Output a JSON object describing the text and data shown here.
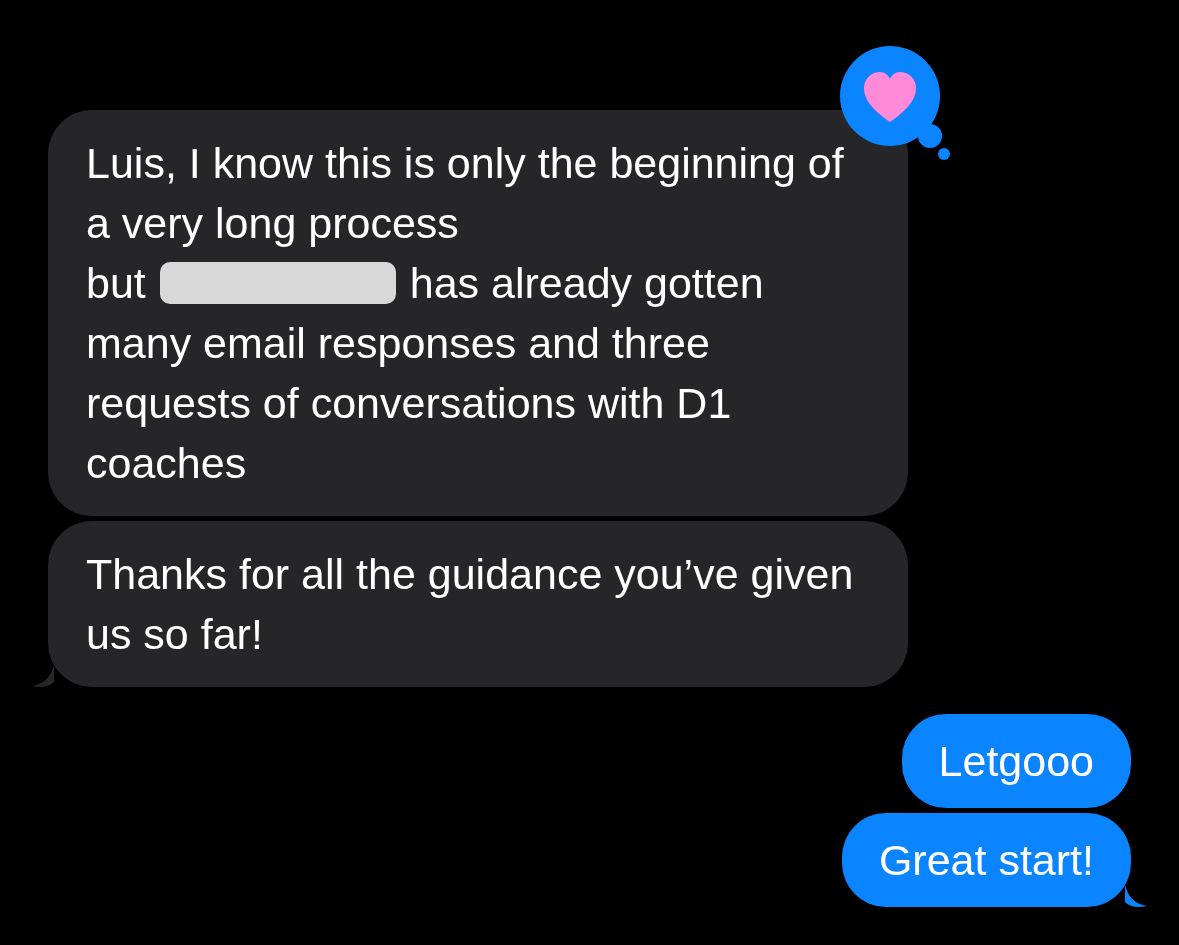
{
  "messages": [
    {
      "kind": "incoming",
      "text_before": "Luis, I know this is only the beginning of a very long process",
      "redaction": {
        "before": "but",
        "after": "has already gotten"
      },
      "text_after": "many email responses and three requests of conversations with D1 coaches",
      "tail": false,
      "reaction": {
        "kind": "heart"
      }
    },
    {
      "kind": "incoming",
      "text_before": "Thanks for all the guidance you’ve given us so far!",
      "tail": true
    },
    {
      "kind": "outgoing",
      "text_before": "Letgooo",
      "tail": false
    },
    {
      "kind": "outgoing",
      "text_before": "Great start!",
      "tail": true
    }
  ]
}
